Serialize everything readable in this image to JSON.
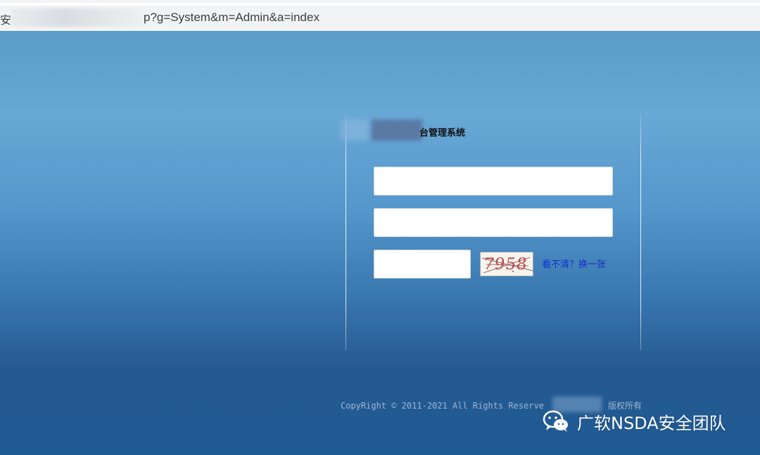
{
  "browser": {
    "url_prefix": "安",
    "url_visible": "p?g=System&m=Admin&a=index"
  },
  "login": {
    "system_title": "台管理系统",
    "username_value": "",
    "password_value": "",
    "captcha_value": "",
    "captcha_image_text": "7958",
    "refresh_link": "看不清？换一张"
  },
  "footer": {
    "copyright": "CopyRight © 2011-2021 All Rights Reserve",
    "copyright_suffix": "版权所有"
  },
  "watermark": {
    "icon": "wechat-icon",
    "text": "广软NSDA安全团队"
  },
  "colors": {
    "background_top": "#68a8d6",
    "background_bottom": "#1f5b94",
    "link": "#1030d0",
    "copyright_text": "#9fb6cf"
  }
}
